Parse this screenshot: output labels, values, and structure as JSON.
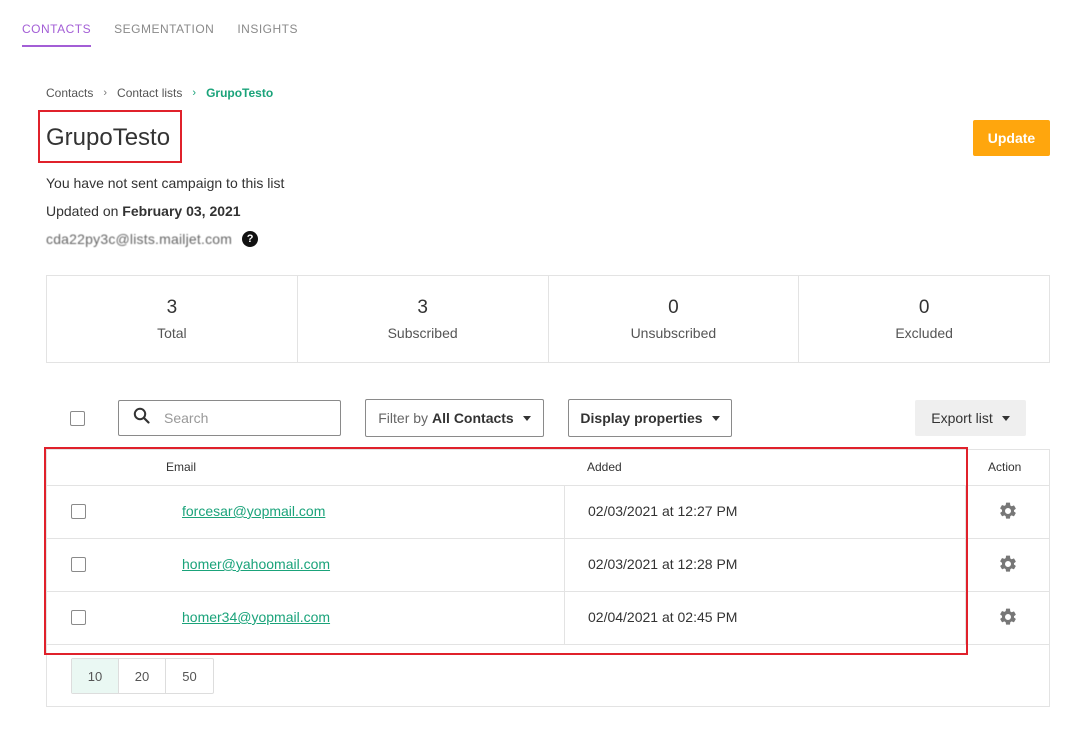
{
  "topnav": {
    "tabs": [
      {
        "label": "CONTACTS",
        "active": true
      },
      {
        "label": "SEGMENTATION",
        "active": false
      },
      {
        "label": "INSIGHTS",
        "active": false
      }
    ]
  },
  "breadcrumb": {
    "items": [
      "Contacts",
      "Contact lists",
      "GrupoTesto"
    ]
  },
  "page": {
    "title": "GrupoTesto",
    "update_label": "Update",
    "campaign_note": "You have not sent campaign to this list",
    "updated_prefix": "Updated on ",
    "updated_date": "February 03, 2021",
    "list_address": "cda22py3c@lists.mailjet.com",
    "help_glyph": "?"
  },
  "stats": [
    {
      "value": "3",
      "label": "Total"
    },
    {
      "value": "3",
      "label": "Subscribed"
    },
    {
      "value": "0",
      "label": "Unsubscribed"
    },
    {
      "value": "0",
      "label": "Excluded"
    }
  ],
  "toolbar": {
    "search_placeholder": "Search",
    "filter_prefix": "Filter by",
    "filter_value": "All Contacts",
    "display_properties_label": "Display properties",
    "export_label": "Export list"
  },
  "table": {
    "columns": {
      "email": "Email",
      "added": "Added",
      "action": "Action"
    },
    "rows": [
      {
        "email": "forcesar@yopmail.com",
        "added": "02/03/2021 at 12:27 PM"
      },
      {
        "email": "homer@yahoomail.com",
        "added": "02/03/2021 at 12:28 PM"
      },
      {
        "email": "homer34@yopmail.com",
        "added": "02/04/2021 at 02:45 PM"
      }
    ]
  },
  "pagination": {
    "sizes": [
      "10",
      "20",
      "50"
    ],
    "selected": "10"
  },
  "colors": {
    "accent_purple": "#a35ed6",
    "link_green": "#1aa37a",
    "update_orange": "#ffa60d",
    "highlight_red": "#e0212b"
  },
  "icons": {
    "search": "search-icon",
    "caret": "caret-down-icon",
    "gear": "gear-icon",
    "help": "help-icon",
    "chevron": "chevron-right-icon"
  }
}
